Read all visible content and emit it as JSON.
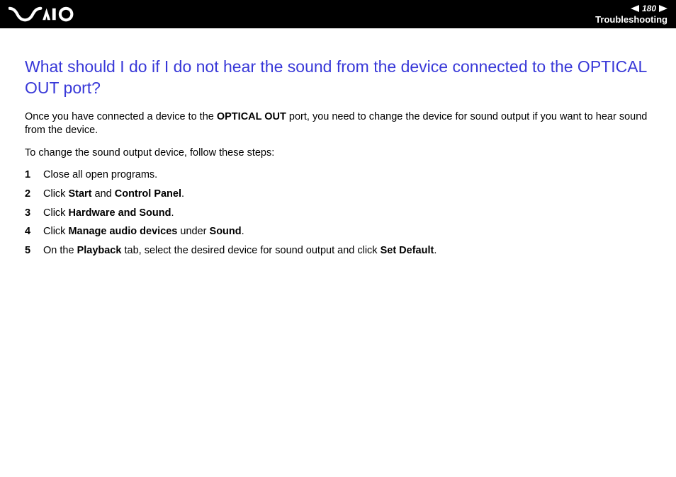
{
  "header": {
    "page_number": "180",
    "section": "Troubleshooting"
  },
  "content": {
    "heading": "What should I do if I do not hear the sound from the device connected to the OPTICAL OUT port?",
    "intro_pre": "Once you have connected a device to the ",
    "intro_bold": "OPTICAL OUT",
    "intro_post": " port, you need to change the device for sound output if you want to hear sound from the device.",
    "instruction": "To change the sound output device, follow these steps:",
    "steps": [
      {
        "num": "1",
        "segments": [
          {
            "text": "Close all open programs.",
            "bold": false
          }
        ]
      },
      {
        "num": "2",
        "segments": [
          {
            "text": "Click ",
            "bold": false
          },
          {
            "text": "Start",
            "bold": true
          },
          {
            "text": " and ",
            "bold": false
          },
          {
            "text": "Control Panel",
            "bold": true
          },
          {
            "text": ".",
            "bold": false
          }
        ]
      },
      {
        "num": "3",
        "segments": [
          {
            "text": "Click ",
            "bold": false
          },
          {
            "text": "Hardware and Sound",
            "bold": true
          },
          {
            "text": ".",
            "bold": false
          }
        ]
      },
      {
        "num": "4",
        "segments": [
          {
            "text": "Click ",
            "bold": false
          },
          {
            "text": "Manage audio devices",
            "bold": true
          },
          {
            "text": " under ",
            "bold": false
          },
          {
            "text": "Sound",
            "bold": true
          },
          {
            "text": ".",
            "bold": false
          }
        ]
      },
      {
        "num": "5",
        "segments": [
          {
            "text": "On the ",
            "bold": false
          },
          {
            "text": "Playback",
            "bold": true
          },
          {
            "text": " tab, select the desired device for sound output and click ",
            "bold": false
          },
          {
            "text": "Set Default",
            "bold": true
          },
          {
            "text": ".",
            "bold": false
          }
        ]
      }
    ]
  }
}
